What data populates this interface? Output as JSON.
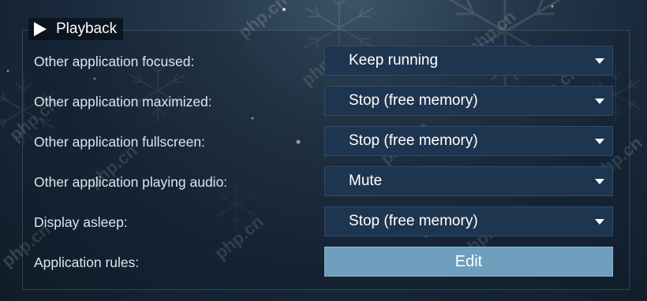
{
  "section": {
    "title": "Playback",
    "icon": "play-icon"
  },
  "settings": [
    {
      "label": "Other application focused:",
      "value": "Keep running"
    },
    {
      "label": "Other application maximized:",
      "value": "Stop (free memory)"
    },
    {
      "label": "Other application fullscreen:",
      "value": "Stop (free memory)"
    },
    {
      "label": "Other application playing audio:",
      "value": "Mute"
    },
    {
      "label": "Display asleep:",
      "value": "Stop (free memory)"
    }
  ],
  "rules": {
    "label": "Application rules:",
    "button_label": "Edit"
  },
  "watermark": "php.cn",
  "colors": {
    "dropdown_bg": "#1e3550",
    "button_bg": "#6e9fbd",
    "text": "#dfe6ec"
  }
}
